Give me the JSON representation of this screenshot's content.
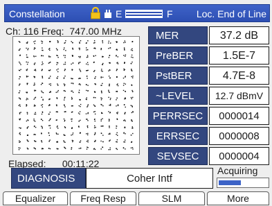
{
  "header": {
    "title": "Constellation",
    "gauge_start": "E",
    "gauge_end": "F",
    "location": "Loc. End of Line"
  },
  "channel": {
    "readout": "Ch: 116 Freq:  747.00 MHz"
  },
  "constellation": {
    "elapsed": "Elapsed:      00:11:22"
  },
  "measurements": [
    {
      "label": "MER",
      "value": "37.2 dB"
    },
    {
      "label": "PreBER",
      "value": "1.5E-7"
    },
    {
      "label": "PstBER",
      "value": "4.7E-8"
    },
    {
      "label": "~LEVEL",
      "value": "12.7 dBmV"
    },
    {
      "label": "PERRSEC",
      "value": "0000014"
    },
    {
      "label": "ERRSEC",
      "value": "0000008"
    },
    {
      "label": "SEVSEC",
      "value": "0000004"
    }
  ],
  "diagnosis": {
    "label": "DIAGNOSIS",
    "value": "Coher Intf"
  },
  "status": {
    "text": "Acquiring",
    "progress": 0.45
  },
  "softkeys": [
    "Equalizer",
    "Freq Resp",
    "SLM",
    "More"
  ],
  "colors": {
    "header_bg": "#2d4fb3",
    "label_bg": "#33477f",
    "progress_fill": "#3c63c7"
  },
  "icons": {
    "lock": "lock-icon",
    "plug": "plug-icon"
  }
}
